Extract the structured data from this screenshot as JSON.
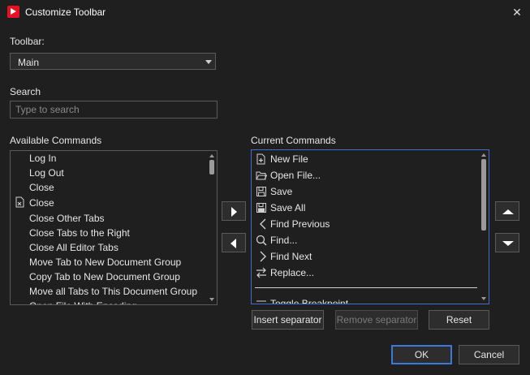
{
  "window": {
    "title": "Customize Toolbar"
  },
  "toolbar_field": {
    "label": "Toolbar:",
    "selected": "Main"
  },
  "search": {
    "label": "Search",
    "placeholder": "Type to search"
  },
  "available": {
    "label": "Available Commands",
    "items": [
      "Log In",
      "Log Out",
      "Close",
      "Close",
      "Close Other Tabs",
      "Close Tabs to the Right",
      "Close All Editor Tabs",
      "Move Tab to New Document Group",
      "Copy Tab to New Document Group",
      "Move all Tabs to This Document Group",
      "Open File With Encoding..."
    ]
  },
  "current": {
    "label": "Current Commands",
    "items": [
      "New File",
      "Open File...",
      "Save",
      "Save All",
      "Find Previous",
      "Find...",
      "Find Next",
      "Replace...",
      "Toggle Breakpoint"
    ]
  },
  "buttons": {
    "insert_separator": "Insert separator",
    "remove_separator": "Remove separator",
    "reset": "Reset",
    "ok": "OK",
    "cancel": "Cancel"
  },
  "colors": {
    "accent": "#3b78d8",
    "app_icon": "#e81123"
  }
}
